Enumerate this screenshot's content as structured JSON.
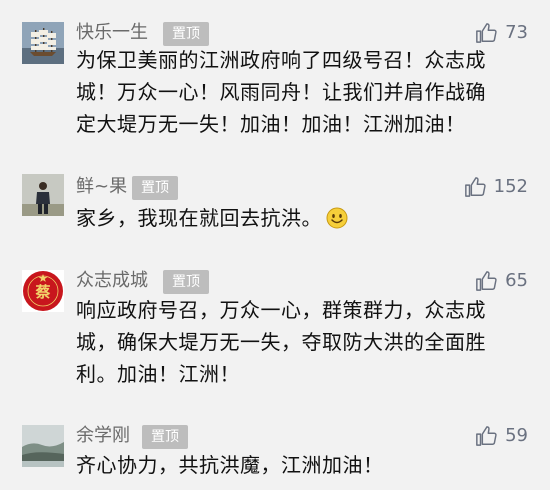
{
  "comments": [
    {
      "author": "快乐一生",
      "pin_label": "置顶",
      "likes": "73",
      "lines": [
        "为保卫美丽的江洲政府响了四级号召！众志成",
        "城！万众一心！风雨同舟！让我们并肩作战确",
        "定大堤万无一失！加油！加油！江洲加油！"
      ],
      "avatar_icon": "sailing-ship-icon"
    },
    {
      "author": "鲜~果",
      "pin_label": "置顶",
      "likes": "152",
      "lines": [
        "家乡，我现在就回去抗洪。"
      ],
      "emoji_icon": "smiley-icon",
      "avatar_icon": "person-photo-icon"
    },
    {
      "author": "众志成城",
      "pin_label": "置顶",
      "likes": "65",
      "lines": [
        "响应政府号召，万众一心，群策群力，众志成",
        "城，确保大堤万无一失，夺取防大洪的全面胜",
        "利。加油！江洲！"
      ],
      "avatar_icon": "red-seal-icon",
      "avatar_text": "蔡"
    },
    {
      "author": "余学刚",
      "pin_label": "置顶",
      "likes": "59",
      "lines": [
        "齐心协力，共抗洪魔，江洲加油！"
      ],
      "avatar_icon": "landscape-photo-icon"
    }
  ],
  "colors": {
    "background": "#f2f2f2",
    "name": "#6a6a6a",
    "pin_bg": "#bdbdbd",
    "like": "#6a7180"
  },
  "like_icon": "thumbs-up-icon"
}
